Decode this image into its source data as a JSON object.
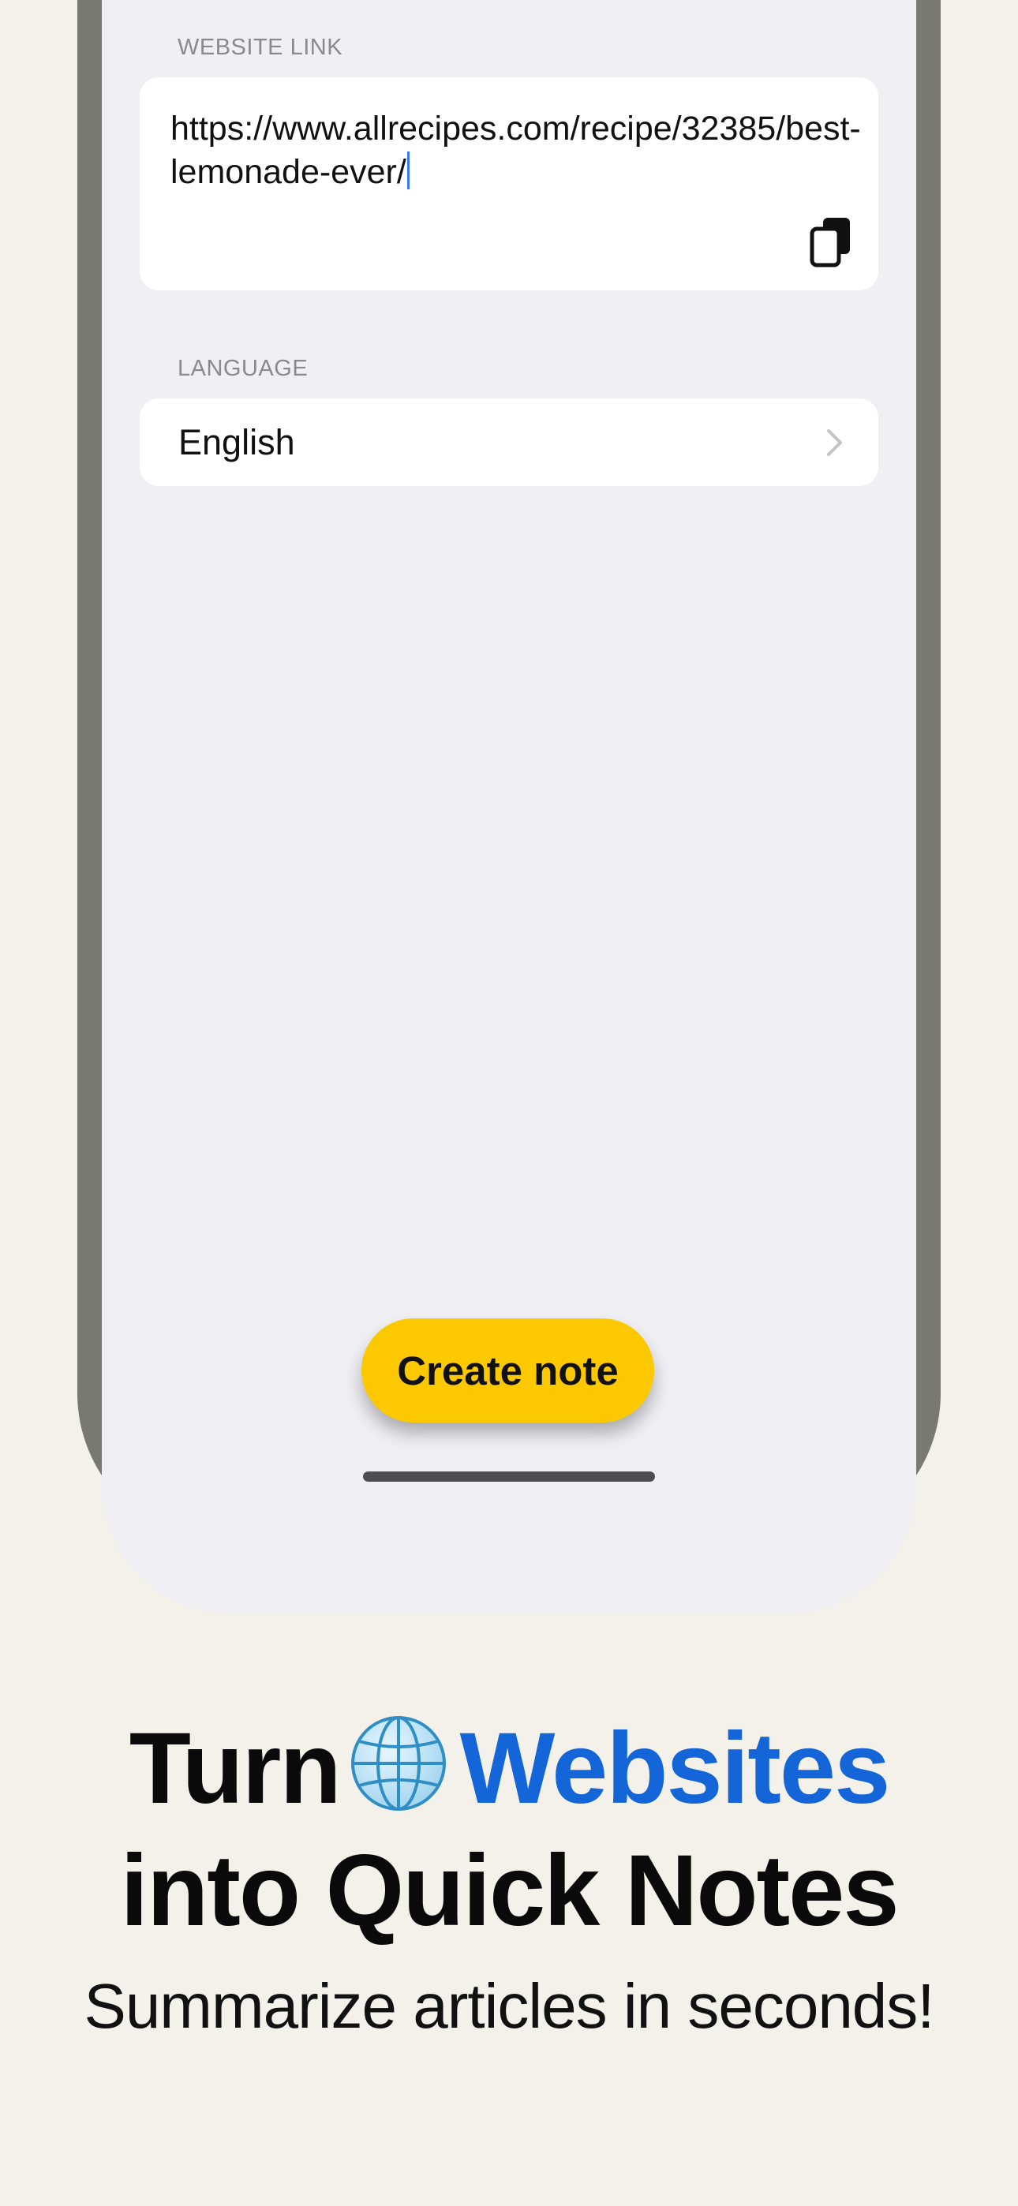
{
  "form": {
    "website_link_label": "WEBSITE LINK",
    "website_link_value": "https://www.allrecipes.com/recipe/32385/best-lemonade-ever/",
    "language_label": "LANGUAGE",
    "language_value": "English",
    "paste_icon": "paste-clipboard-icon",
    "chevron_icon": "chevron-right-icon"
  },
  "actions": {
    "create_note_label": "Create note"
  },
  "promo": {
    "headline_word1": "Turn",
    "headline_accent": "Websites",
    "headline_line2": "into Quick Notes",
    "subtitle": "Summarize articles in seconds!",
    "globe_icon": "globe-icon"
  },
  "colors": {
    "background": "#f3f1ea",
    "screen": "#efeff4",
    "bezel": "#787970",
    "button": "#fcc900",
    "accent": "#1466d8"
  }
}
